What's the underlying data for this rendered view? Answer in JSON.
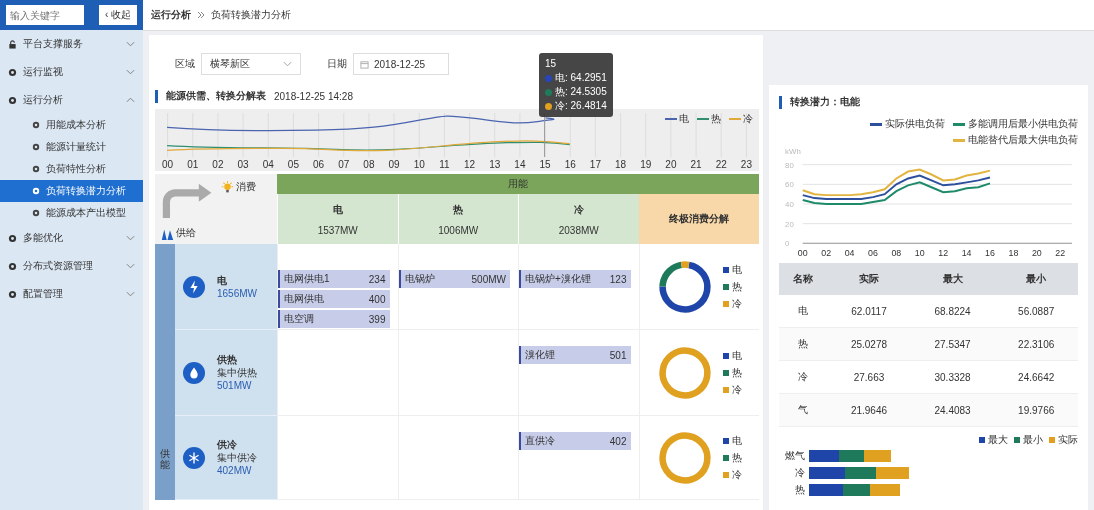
{
  "sidebar": {
    "search": {
      "placeholder": "输入关键字"
    },
    "collapse_button": "‹ 收起",
    "items": [
      {
        "label": "平台支撑服务",
        "kind": "lock",
        "expanded": false
      },
      {
        "label": "运行监视",
        "kind": "dot",
        "expanded": false
      },
      {
        "label": "运行分析",
        "kind": "dot",
        "expanded": true,
        "children": [
          {
            "label": "用能成本分析",
            "selected": false
          },
          {
            "label": "能源计量统计",
            "selected": false
          },
          {
            "label": "负荷特性分析",
            "selected": false
          },
          {
            "label": "负荷转换潜力分析",
            "selected": true
          },
          {
            "label": "能源成本产出模型",
            "selected": false
          }
        ]
      },
      {
        "label": "多能优化",
        "kind": "dot",
        "expanded": false
      },
      {
        "label": "分布式资源管理",
        "kind": "dot",
        "expanded": false
      },
      {
        "label": "配置管理",
        "kind": "dot",
        "expanded": false
      }
    ]
  },
  "breadcrumb": [
    "运行分析",
    "负荷转换潜力分析"
  ],
  "filters": {
    "region": {
      "label": "区域",
      "value": "横琴新区"
    },
    "date": {
      "label": "日期",
      "value": "2018-12-25"
    }
  },
  "supply_panel": {
    "title": "能源供需、转换分解表",
    "timestamp": "2018-12-25 14:28",
    "trend": {
      "legend": [
        {
          "label": "电",
          "color": "#4a64b0"
        },
        {
          "label": "热",
          "color": "#2f8f6f"
        },
        {
          "label": "冷",
          "color": "#e0a93a"
        }
      ],
      "hours": [
        "00",
        "01",
        "02",
        "03",
        "04",
        "05",
        "06",
        "07",
        "08",
        "09",
        "10",
        "11",
        "12",
        "13",
        "14",
        "15",
        "16",
        "17",
        "18",
        "19",
        "20",
        "21",
        "22",
        "23"
      ],
      "tooltip": {
        "title": "15",
        "items": [
          {
            "label": "电: 64.2951",
            "color": "#2745b8"
          },
          {
            "label": "热: 24.5305",
            "color": "#1f7a5c"
          },
          {
            "label": "冷: 26.4814",
            "color": "#e0a020"
          }
        ]
      }
    },
    "table": {
      "consume_label": "消费",
      "supply_label": "供给",
      "group_header": "用能",
      "columns": [
        {
          "name": "电",
          "value": "1537MW"
        },
        {
          "name": "热",
          "value": "1006MW"
        },
        {
          "name": "冷",
          "value": "2038MW"
        }
      ],
      "breakdown_header": "终极消费分解",
      "side_label": "供能",
      "rows": [
        {
          "kind": "power",
          "name": "电",
          "value": "1656MW",
          "cells": [
            [
              {
                "label": "电网供电1",
                "value": "234"
              },
              {
                "label": "电网供电",
                "value": "400"
              },
              {
                "label": "电空调",
                "value": "399"
              }
            ],
            [
              {
                "label": "电锅炉",
                "value": "500MW"
              }
            ],
            [
              {
                "label": "电锅炉+溴化锂",
                "value": "123"
              }
            ]
          ],
          "donut_legend": [
            {
              "label": "电",
              "color": "#1f45a8"
            },
            {
              "label": "热",
              "color": "#1f7a5c"
            },
            {
              "label": "冷",
              "color": "#e0a020"
            }
          ]
        },
        {
          "kind": "heat",
          "name": "供热",
          "sub": "集中供热",
          "value": "501MW",
          "cells": [
            [],
            [],
            [
              {
                "label": "溴化锂",
                "value": "501"
              }
            ]
          ],
          "donut_legend": [
            {
              "label": "电",
              "color": "#1f45a8"
            },
            {
              "label": "热",
              "color": "#1f7a5c"
            },
            {
              "label": "冷",
              "color": "#e0a020"
            }
          ]
        },
        {
          "kind": "cold",
          "name": "供冷",
          "sub": "集中供冷",
          "value": "402MW",
          "cells": [
            [],
            [],
            [
              {
                "label": "直供冷",
                "value": "402"
              }
            ]
          ],
          "donut_legend": [
            {
              "label": "电",
              "color": "#1f45a8"
            },
            {
              "label": "热",
              "color": "#1f7a5c"
            },
            {
              "label": "冷",
              "color": "#e0a020"
            }
          ]
        }
      ]
    }
  },
  "potential_panel": {
    "title": "转换潜力：电能",
    "chart_data": {
      "type": "line",
      "grid": true,
      "ylabel": "kWh",
      "x": [
        0,
        1,
        2,
        3,
        4,
        5,
        6,
        7,
        8,
        9,
        10,
        11,
        12,
        13,
        14,
        15,
        16
      ],
      "xlim": [
        0,
        23
      ],
      "ylim": [
        0,
        80
      ],
      "xticks": [
        {
          "value": 0,
          "label": "00"
        },
        {
          "value": 2,
          "label": "02"
        },
        {
          "value": 4,
          "label": "04"
        },
        {
          "value": 6,
          "label": "06"
        },
        {
          "value": 8,
          "label": "08"
        },
        {
          "value": 10,
          "label": "10"
        },
        {
          "value": 12,
          "label": "12"
        },
        {
          "value": 14,
          "label": "14"
        },
        {
          "value": 16,
          "label": "16"
        },
        {
          "value": 18,
          "label": "18"
        },
        {
          "value": 20,
          "label": "20"
        },
        {
          "value": 22,
          "label": "22"
        }
      ],
      "yticks": [
        0,
        20,
        40,
        60,
        80
      ],
      "series": [
        {
          "name": "实际供电负荷",
          "color": "#2d4f9c",
          "values": [
            49,
            46,
            45,
            45,
            45,
            45,
            47,
            50,
            60,
            66,
            69,
            64,
            59,
            60,
            62,
            64,
            67
          ]
        },
        {
          "name": "多能调用后最小供电负荷",
          "color": "#1f8a6a",
          "values": [
            44,
            41,
            40,
            40,
            40,
            40,
            42,
            44,
            53,
            59,
            62,
            57,
            52,
            53,
            56,
            57,
            61
          ]
        },
        {
          "name": "电能替代后最大供电负荷",
          "color": "#e2b440",
          "values": [
            54,
            50,
            49,
            49,
            49,
            50,
            52,
            55,
            66,
            73,
            75,
            70,
            64,
            65,
            69,
            71,
            74
          ]
        }
      ]
    },
    "table": {
      "columns": [
        "名称",
        "实际",
        "最大",
        "最小"
      ],
      "rows": [
        [
          "电",
          "62.0117",
          "68.8224",
          "56.0887"
        ],
        [
          "热",
          "25.0278",
          "27.5347",
          "22.3106"
        ],
        [
          "冷",
          "27.663",
          "30.3328",
          "24.6642"
        ],
        [
          "气",
          "21.9646",
          "24.4083",
          "19.9766"
        ]
      ]
    },
    "bar_legend": [
      {
        "label": "最大",
        "color": "#1f45a8"
      },
      {
        "label": "最小",
        "color": "#1f7a5c"
      },
      {
        "label": "实际",
        "color": "#e0a020"
      }
    ],
    "bar_categories": [
      "燃气",
      "冷",
      "热"
    ]
  }
}
